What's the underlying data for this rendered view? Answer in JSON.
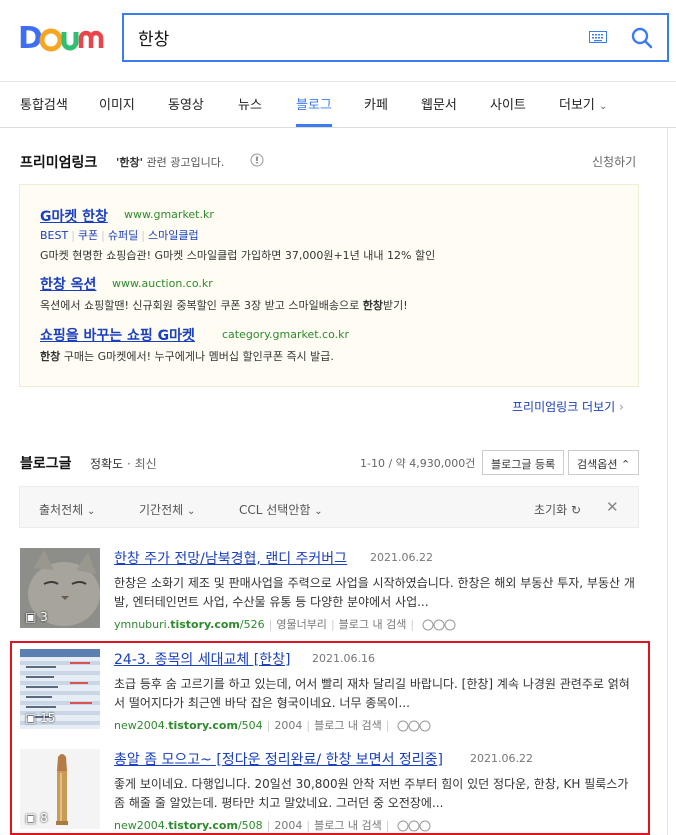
{
  "header": {
    "search_value": "한창",
    "logo_text": "Daum"
  },
  "tabs": [
    {
      "label": "통합검색"
    },
    {
      "label": "이미지"
    },
    {
      "label": "동영상"
    },
    {
      "label": "뉴스"
    },
    {
      "label": "블로그"
    },
    {
      "label": "카페"
    },
    {
      "label": "웹문서"
    },
    {
      "label": "사이트"
    },
    {
      "label": "더보기"
    }
  ],
  "premium": {
    "title": "프리미엄링크",
    "keyword": "'한창'",
    "desc": " 관련 광고입니다.",
    "apply": "신청하기",
    "more": "프리미엄링크 더보기",
    "ads": [
      {
        "title": "G마켓 한창",
        "url": "www.gmarket.kr",
        "subs": [
          "BEST",
          "쿠폰",
          "슈퍼딜",
          "스마일클럽"
        ],
        "text": "G마켓 현명한 쇼핑습관! G마켓 스마일클럽 가입하면 37,000원+1년 내내 12% 할인"
      },
      {
        "title": "한창 옥션",
        "url": "www.auction.co.kr",
        "text_pre": "옥션에서 쇼핑할땐! 신규회원 중복할인 쿠폰 3장 받고 스마일배송으로 ",
        "text_bold": "한창",
        "text_post": "받기!"
      },
      {
        "title": "쇼핑을 바꾸는 쇼핑 G마켓",
        "url": "category.gmarket.co.kr",
        "text_bold": "한창",
        "text_post": " 구매는 G마켓에서! 누구에게나 멤버십 할인쿠폰 즉시 발급."
      }
    ]
  },
  "blog": {
    "title": "블로그글",
    "sort_active": "정확도",
    "sort_other": "최신",
    "count": "1-10 / 약 4,930,000건",
    "register_btn": "블로그글 등록",
    "options_btn": "검색옵션"
  },
  "filters": {
    "source": "출처전체",
    "period": "기간전체",
    "ccl": "CCL 선택안함",
    "reset": "초기화"
  },
  "results": [
    {
      "title": "한창 주가 전망/남북경협, 랜디 주커버그",
      "date": "2021.06.22",
      "snippet": "한창은 소화기 제조 및 판매사업을 주력으로 사업을 시작하였습니다. 한창은 해외 부동산 투자, 부동산 개발, 엔터테인먼트 사업, 수산물 유통 등 다양한 분야에서 사업...",
      "url_pre": "ymnuburi.",
      "url_bold": "tistory.com",
      "url_post": "/526",
      "blog_name": "영물너부리",
      "blog_search": "블로그 내 검색",
      "thumb_count": "3"
    },
    {
      "title": "24-3. 종목의 세대교체 [한창]",
      "date": "2021.06.16",
      "snippet": "초급 등후 숨 고르기를 하고 있는데, 어서 빨리 재차 달리길 바랍니다. [한창] 계속 나경원 관련주로 얽혀서 떨어지다가 최근엔 바닥 잡은 형국이네요. 너무 종목이...",
      "url_pre": "new2004.",
      "url_bold": "tistory.com",
      "url_post": "/504",
      "blog_name": "2004",
      "blog_search": "블로그 내 검색",
      "thumb_count": "15"
    },
    {
      "title": "총알 좀 모으고~ [정다운 정리완료/ 한창 보면서 정리중]",
      "date": "2021.06.22",
      "snippet": "좋게 보이네요. 다행입니다. 20일선 30,800원 안착 저번 주부터 힘이 있던 정다운, 한창, KH 필룩스가 좀 해줄 줄 알았는데. 평타만 치고 말았네요. 그러던 중 오전장에...",
      "url_pre": "new2004.",
      "url_bold": "tistory.com",
      "url_post": "/508",
      "blog_name": "2004",
      "blog_search": "블로그 내 검색",
      "thumb_count": "8"
    }
  ]
}
